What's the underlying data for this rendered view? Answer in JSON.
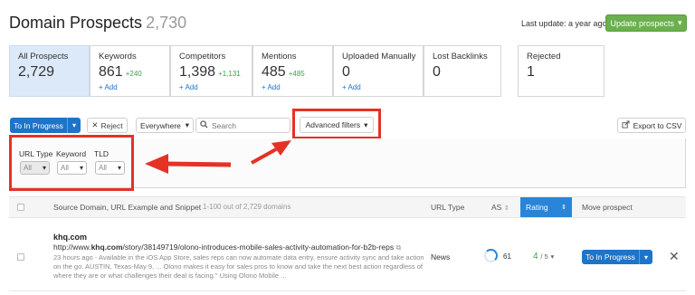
{
  "header": {
    "title": "Domain Prospects",
    "count": "2,730",
    "last_update": "Last update: a year ago",
    "update_button": "Update prospects"
  },
  "tabs": [
    {
      "label": "All Prospects",
      "value": "2,729",
      "delta": "",
      "add": ""
    },
    {
      "label": "Keywords",
      "value": "861",
      "delta": "+240",
      "add": "+ Add"
    },
    {
      "label": "Competitors",
      "value": "1,398",
      "delta": "+1,131",
      "add": "+ Add"
    },
    {
      "label": "Mentions",
      "value": "485",
      "delta": "+485",
      "add": "+ Add"
    },
    {
      "label": "Uploaded Manually",
      "value": "0",
      "delta": "",
      "add": "+ Add"
    },
    {
      "label": "Lost Backlinks",
      "value": "0",
      "delta": "",
      "add": ""
    },
    {
      "label": "Rejected",
      "value": "1",
      "delta": "",
      "add": ""
    }
  ],
  "toolbar": {
    "move_button": "To In Progress",
    "reject_button": "Reject",
    "scope_select": "Everywhere",
    "search_placeholder": "Search",
    "advanced_filters": "Advanced filters",
    "export_button": "Export to CSV"
  },
  "filters": [
    {
      "label": "URL Type",
      "value": "All"
    },
    {
      "label": "Keyword",
      "value": "All"
    },
    {
      "label": "TLD",
      "value": "All"
    }
  ],
  "table": {
    "col_source": "Source Domain, URL Example and Snippet",
    "range": "1-100 out of 2,729 domains",
    "col_url_type": "URL Type",
    "col_as": "AS",
    "col_rating": "Rating",
    "col_move": "Move prospect",
    "rows": [
      {
        "domain": "khq.com",
        "url_prefix": "http://www.",
        "url_domain": "khq.com",
        "url_path": "/story/38149719/olono-introduces-mobile-sales-activity-automation-for-b2b-reps",
        "snippet": "23 hours ago - Available in the iOS App Store, sales reps can now automate data entry, ensure activity sync and take action on the go. AUSTIN, Texas-May 9, ... Olono makes it easy for sales pros to know and take the next best action regardless of where they are or what challenges their deal is facing.\" Using Olono Mobile ...",
        "url_type": "News",
        "as": "61",
        "rating": "4",
        "rating_max": "/ 5",
        "move_button": "To In Progress"
      }
    ]
  },
  "colors": {
    "accent_blue": "#1e74c9",
    "update_green": "#6ab04c",
    "highlight_red": "#e53225",
    "active_tab_bg": "#dbe9f9"
  }
}
